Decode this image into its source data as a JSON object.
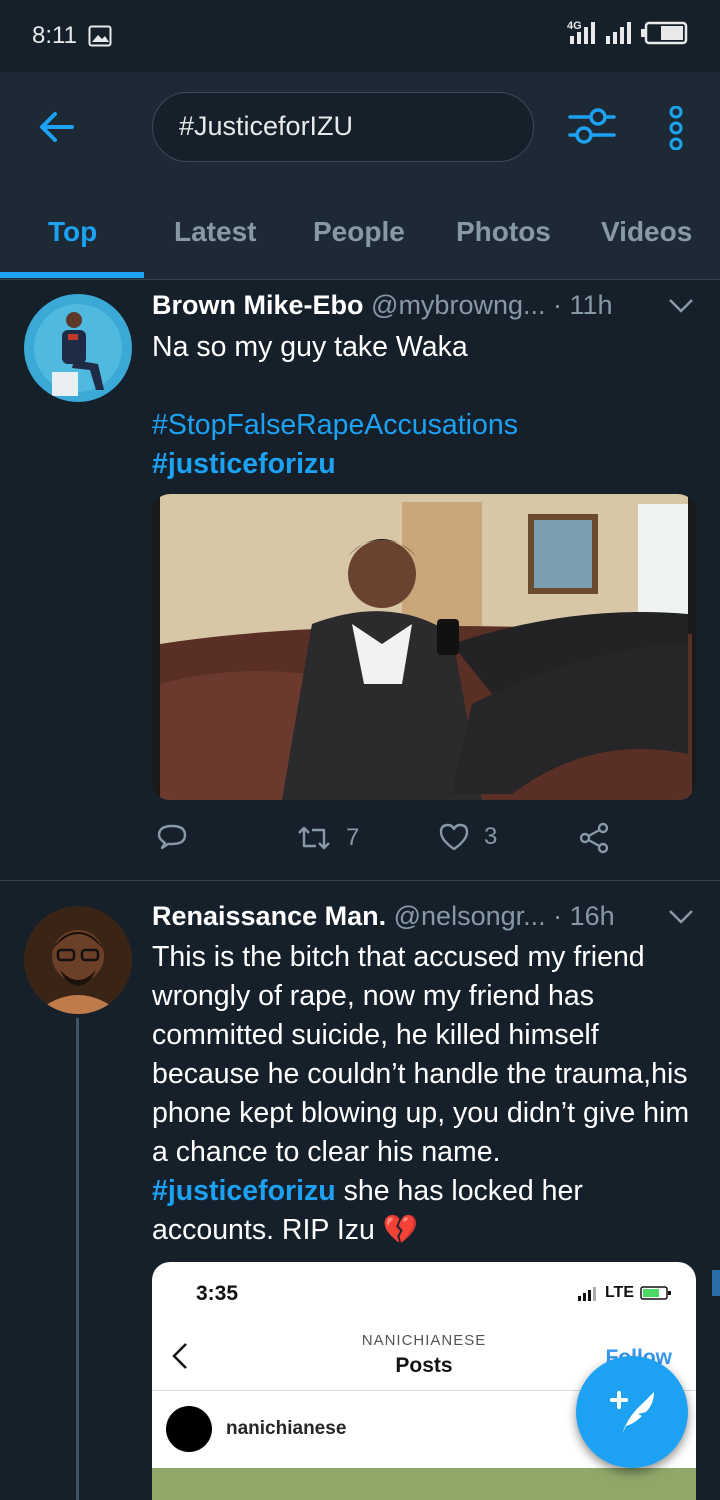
{
  "status_bar": {
    "time": "8:11",
    "network_label": "4G",
    "icons": [
      "gallery-icon",
      "signal-icon",
      "signal-icon",
      "battery-icon"
    ]
  },
  "search": {
    "query": "#JusticeforIZU",
    "back_icon": "arrow-left-icon",
    "filter_icon": "sliders-icon",
    "more_icon": "more-vertical-icon"
  },
  "tabs": [
    {
      "label": "Top",
      "active": true
    },
    {
      "label": "Latest",
      "active": false
    },
    {
      "label": "People",
      "active": false
    },
    {
      "label": "Photos",
      "active": false
    },
    {
      "label": "Videos",
      "active": false
    }
  ],
  "tweets": [
    {
      "name": "Brown Mike-Ebo",
      "handle": "@mybrowng...",
      "time": "· 11h",
      "text": "Na so my guy take Waka",
      "hashtag1": "#StopFalseRapeAccusations",
      "hashtag2": "#justiceforizu",
      "retweets": "7",
      "likes": "3",
      "media_alt": "photo"
    },
    {
      "name": "Renaissance Man.",
      "handle": "@nelsongr...",
      "time": "· 16h",
      "text_part1": "This is the bitch that accused my friend wrongly of rape, now my friend has committed suicide, he killed himself because he couldn’t handle the trauma,his phone kept blowing up, you didn’t give him a chance to clear his name. ",
      "hashtag": "#justiceforizu",
      "text_part2": " she has locked her accounts. RIP Izu ",
      "emoji": "💔",
      "screenshot": {
        "time": "3:35",
        "network": "LTE",
        "account": "NANICHIANESE",
        "title": "Posts",
        "follow": "Follow",
        "username": "nanichianese"
      }
    }
  ],
  "colors": {
    "background": "#15202b",
    "header": "#1d2a35",
    "accent": "#1da1f2",
    "muted": "#8899a6",
    "divider": "#38444d"
  }
}
